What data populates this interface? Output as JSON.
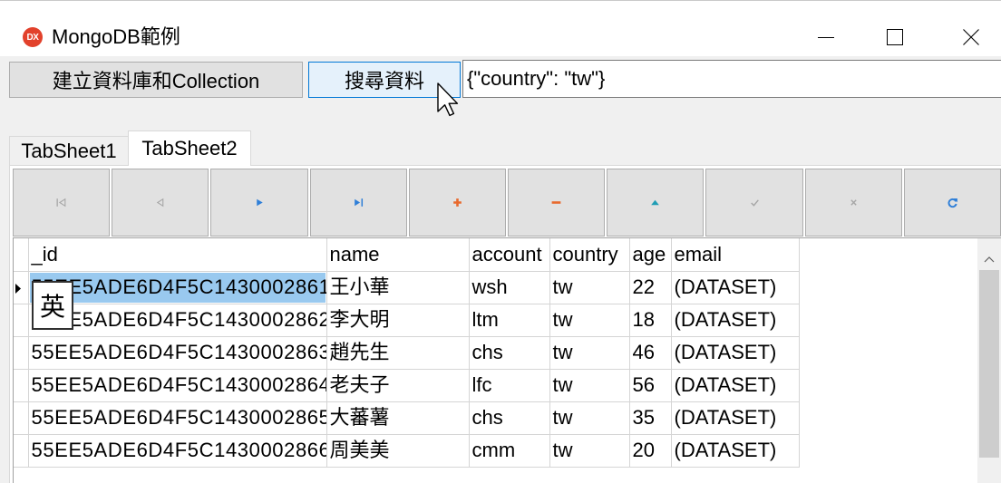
{
  "window": {
    "title": "MongoDB範例",
    "app_icon": "dx-app-icon",
    "app_icon_text": "DX",
    "controls": {
      "minimize": "minimize-icon",
      "maximize": "maximize-icon",
      "close": "close-icon"
    }
  },
  "toolbar": {
    "create_button_label": "建立資料庫和Collection",
    "search_button_label": "搜尋資料",
    "query_input_value": "{\"country\": \"tw\"}"
  },
  "tabs": [
    {
      "label": "TabSheet1",
      "selected": false
    },
    {
      "label": "TabSheet2",
      "selected": true
    }
  ],
  "navigator": {
    "buttons": [
      {
        "icon": "first-record-icon",
        "enabled": false
      },
      {
        "icon": "prior-record-icon",
        "enabled": false
      },
      {
        "icon": "next-record-icon",
        "enabled": true
      },
      {
        "icon": "last-record-icon",
        "enabled": true
      },
      {
        "icon": "insert-record-icon",
        "enabled": true
      },
      {
        "icon": "delete-record-icon",
        "enabled": true
      },
      {
        "icon": "edit-record-icon",
        "enabled": true
      },
      {
        "icon": "post-edit-icon",
        "enabled": false
      },
      {
        "icon": "cancel-edit-icon",
        "enabled": false
      },
      {
        "icon": "refresh-data-icon",
        "enabled": true
      }
    ]
  },
  "grid": {
    "columns": [
      "_id",
      "name",
      "account",
      "country",
      "age",
      "email"
    ],
    "rows": [
      {
        "_id": "55EE5ADE6D4F5C1430002861",
        "name": "王小華",
        "account": "wsh",
        "country": "tw",
        "age": 22,
        "email": "(DATASET)"
      },
      {
        "_id": "55EE5ADE6D4F5C1430002862",
        "name": "李大明",
        "account": "ltm",
        "country": "tw",
        "age": 18,
        "email": "(DATASET)"
      },
      {
        "_id": "55EE5ADE6D4F5C1430002863",
        "name": "趙先生",
        "account": "chs",
        "country": "tw",
        "age": 46,
        "email": "(DATASET)"
      },
      {
        "_id": "55EE5ADE6D4F5C1430002864",
        "name": "老夫子",
        "account": "lfc",
        "country": "tw",
        "age": 56,
        "email": "(DATASET)"
      },
      {
        "_id": "55EE5ADE6D4F5C1430002865",
        "name": "大蕃薯",
        "account": "chs",
        "country": "tw",
        "age": 35,
        "email": "(DATASET)"
      },
      {
        "_id": "55EE5ADE6D4F5C1430002866",
        "name": "周美美",
        "account": "cmm",
        "country": "tw",
        "age": 20,
        "email": "(DATASET)"
      }
    ],
    "current_row": 0,
    "selected_cell": {
      "row": 0,
      "col": 0
    }
  },
  "ime_indicator": "英",
  "cursor_icon": "arrow-cursor-icon",
  "colors": {
    "window_bg": "#f0f0f0",
    "selection": "#99c9ef",
    "hover_button_bg": "#e5f1fb",
    "hover_button_border": "#0078d7",
    "app_icon": "#e2412b",
    "nav_blue": "#2f7fd8",
    "nav_orange": "#e8692c",
    "nav_teal": "#1f9db5",
    "nav_disabled": "#a6a6a6"
  }
}
